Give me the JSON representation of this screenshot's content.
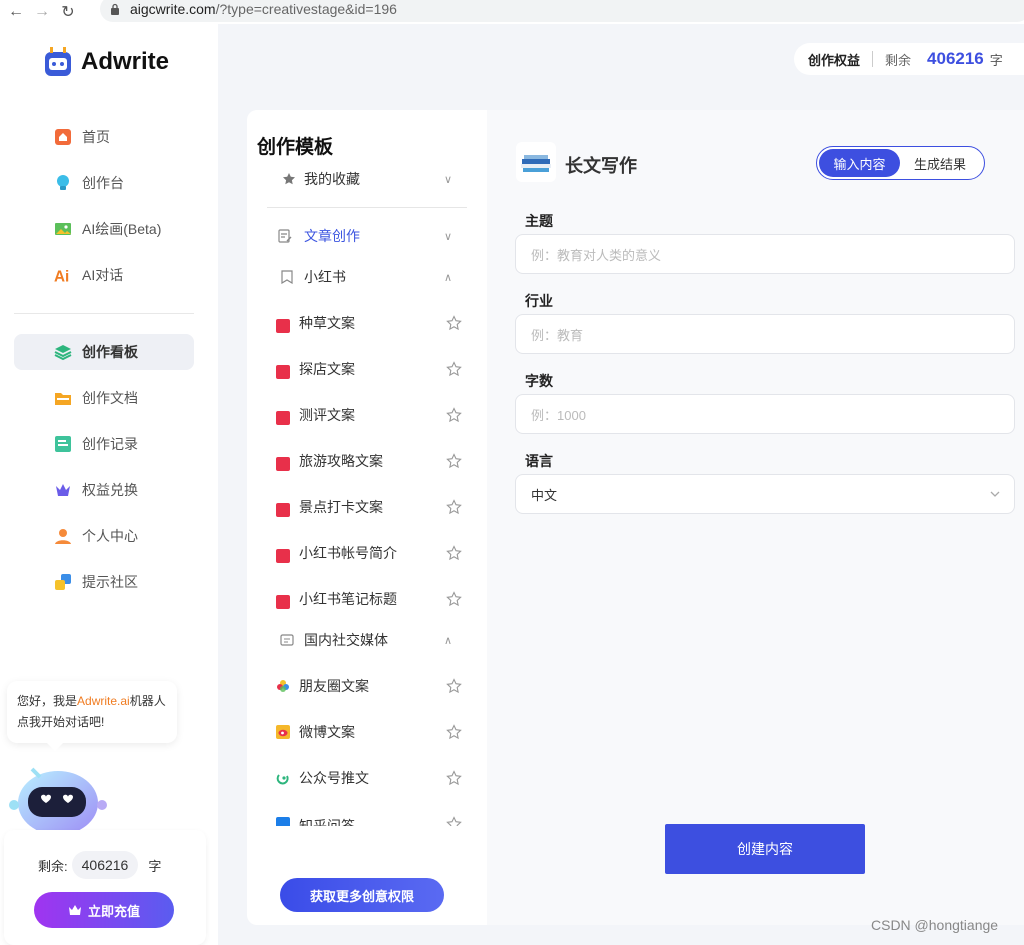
{
  "browser": {
    "url_host": "aigcwrite.com",
    "url_path": "/?type=creativestage&id=196"
  },
  "sidebar": {
    "logo_text": "Adwrite",
    "nav": [
      {
        "label": "首页",
        "icon": "home-icon"
      },
      {
        "label": "创作台",
        "icon": "bulb-icon"
      },
      {
        "label": "AI绘画(Beta)",
        "icon": "image-icon"
      },
      {
        "label": "AI对话",
        "icon": "ai-icon"
      },
      {
        "label": "创作看板",
        "icon": "layers-icon",
        "active": true
      },
      {
        "label": "创作文档",
        "icon": "folder-icon"
      },
      {
        "label": "创作记录",
        "icon": "record-icon"
      },
      {
        "label": "权益兑换",
        "icon": "crown-icon"
      },
      {
        "label": "个人中心",
        "icon": "user-icon"
      },
      {
        "label": "提示社区",
        "icon": "community-icon"
      }
    ],
    "bubble_prefix": "您好，我是",
    "bubble_brand": "Adwrite.ai",
    "bubble_suffix": "机器人点我开始对话吧!",
    "balance_label": "剩余:",
    "balance_value": "406216",
    "balance_unit": "字",
    "charge_label": "立即充值"
  },
  "header": {
    "quota_title": "创作权益",
    "quota_remaining_label": "剩余",
    "quota_value": "406216",
    "quota_unit": "字"
  },
  "templates": {
    "title": "创作模板",
    "favorites": "我的收藏",
    "article": "文章创作",
    "xhs_group": "小红书",
    "xhs_items": [
      "种草文案",
      "探店文案",
      "测评文案",
      "旅游攻略文案",
      "景点打卡文案",
      "小红书帐号简介",
      "小红书笔记标题"
    ],
    "social_group": "国内社交媒体",
    "social_items": [
      "朋友圈文案",
      "微博文案",
      "公众号推文",
      "知乎问答"
    ],
    "more_label": "获取更多创意权限"
  },
  "form": {
    "title": "长文写作",
    "tab_input": "输入内容",
    "tab_result": "生成结果",
    "topic_label": "主题",
    "topic_placeholder": "例：教育对人类的意义",
    "industry_label": "行业",
    "industry_placeholder": "例：教育",
    "words_label": "字数",
    "words_placeholder": "例：1000",
    "lang_label": "语言",
    "lang_value": "中文",
    "create_label": "创建内容"
  },
  "watermark": "CSDN @hongtiange",
  "colors": {
    "accent": "#3d4fe0",
    "brand_orange": "#f07c22",
    "xhs_red": "#e8304a"
  }
}
